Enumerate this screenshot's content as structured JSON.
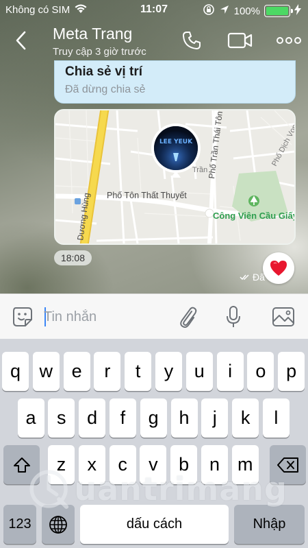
{
  "status_bar": {
    "carrier": "Không có SIM",
    "time": "11:07",
    "battery_percent": "100%",
    "battery_level": 1.0,
    "colors": {
      "battery": "#4cd964"
    }
  },
  "header": {
    "contact_name": "Meta Trang",
    "contact_status": "Truy cập 3 giờ trước"
  },
  "messages": {
    "location_title": "Chia sẻ vị trí",
    "location_subtitle": "Đã dừng chia sẻ",
    "map": {
      "street_1": "Phố Tôn Thất Thuyết",
      "street_2": "Phố Trần Thái Tôn",
      "street_3": "Phố Dịch Vọng",
      "street_4": "Dương Hùng",
      "street_5": "Trần",
      "park": "Công Viên Cầu Giấy",
      "marker_text": "LEE YEUK"
    },
    "time": "18:08",
    "seen_label": "Đã",
    "reaction_icon": "heart-icon"
  },
  "composer": {
    "placeholder": "Tin nhắn"
  },
  "keyboard": {
    "row1": [
      "q",
      "w",
      "e",
      "r",
      "t",
      "y",
      "u",
      "i",
      "o",
      "p"
    ],
    "row2": [
      "a",
      "s",
      "d",
      "f",
      "g",
      "h",
      "j",
      "k",
      "l"
    ],
    "row3": [
      "z",
      "x",
      "c",
      "v",
      "b",
      "n",
      "m"
    ],
    "numbers_key": "123",
    "space_key": "dấu cách",
    "return_key": "Nhập"
  },
  "watermark": {
    "text": "uantrimang"
  },
  "colors": {
    "accent": "#3b86f7",
    "bubble": "#d3ecf9",
    "park_green": "#2f9e4f",
    "heart": "#e8172f"
  }
}
